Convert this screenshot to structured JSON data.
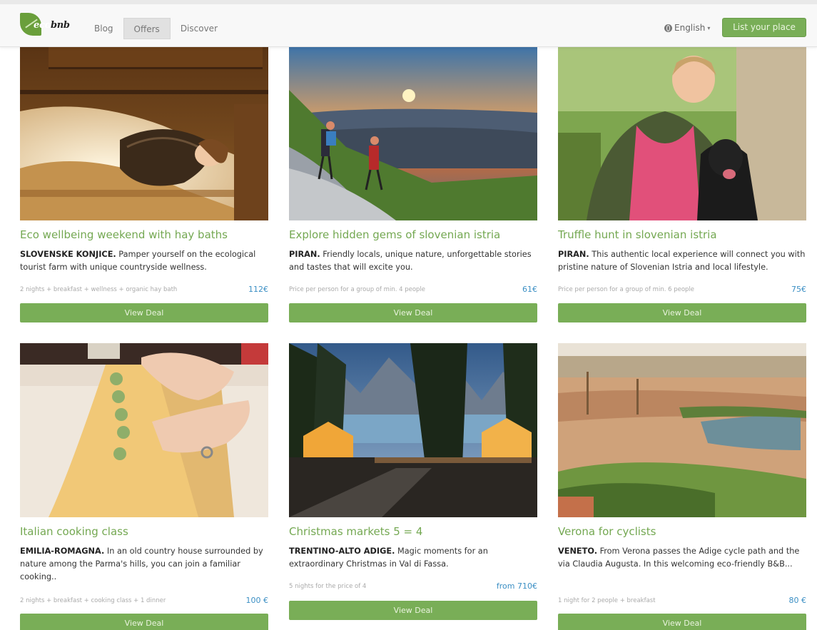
{
  "brand": {
    "logo_text_eco": "eco",
    "logo_text_bnb": "bnb"
  },
  "nav": {
    "links": [
      "Blog",
      "Offers",
      "Discover"
    ],
    "active": "Offers",
    "language": "English",
    "cta_label": "List your place"
  },
  "colors": {
    "accent_green": "#79ae57",
    "title_green": "#74a852",
    "price_blue": "#3b8fc4"
  },
  "cards": [
    {
      "title": "Eco wellbeing weekend with hay baths",
      "region": "SLOVENSKE KONJICE.",
      "text": " Pamper yourself on the ecological tourist farm with unique countryside wellness.",
      "note": "2 nights + breakfast + wellness + organic hay bath",
      "price": "112€",
      "button": "View Deal",
      "image_icon": "hay-bath-photo"
    },
    {
      "title": "Explore hidden gems of slovenian istria",
      "region": "PIRAN.",
      "text": " Friendly locals, unique nature, unforgettable stories and tastes that will excite you.",
      "note": "Price per person for a group of min. 4 people",
      "price": "61€",
      "button": "View Deal",
      "image_icon": "hikers-sunset-photo"
    },
    {
      "title": "Truffle hunt in slovenian istria",
      "region": "PIRAN.",
      "text": " This authentic local experience will connect you with pristine nature of Slovenian Istria and local lifestyle.",
      "note": "Price per person for a group of min. 6 people",
      "price": "75€",
      "button": "View Deal",
      "image_icon": "truffle-dog-photo"
    },
    {
      "title": "Italian cooking class",
      "region": "EMILIA-ROMAGNA.",
      "text": " In an old country house surrounded by nature among the Parma's hills, you can join a familiar cooking..",
      "note": "2 nights + breakfast + cooking class + 1 dinner",
      "price": "100 €",
      "button": "View Deal",
      "image_icon": "pasta-making-photo"
    },
    {
      "title": "Christmas markets 5 = 4",
      "region": "TRENTINO-ALTO ADIGE.",
      "text": " Magic moments for an extraordinary Christmas in Val di Fassa.",
      "note": "5 nights for the price of 4",
      "price": "from 710€",
      "button": "View Deal",
      "image_icon": "christmas-market-photo"
    },
    {
      "title": "Verona for cyclists",
      "region": "VENETO.",
      "text": " From Verona passes the Adige cycle path and the via Claudia Augusta. In this welcoming eco-friendly B&B...",
      "note": "1 night for 2 people + breakfast",
      "price": "80 €",
      "button": "View Deal",
      "image_icon": "verona-city-photo"
    }
  ]
}
